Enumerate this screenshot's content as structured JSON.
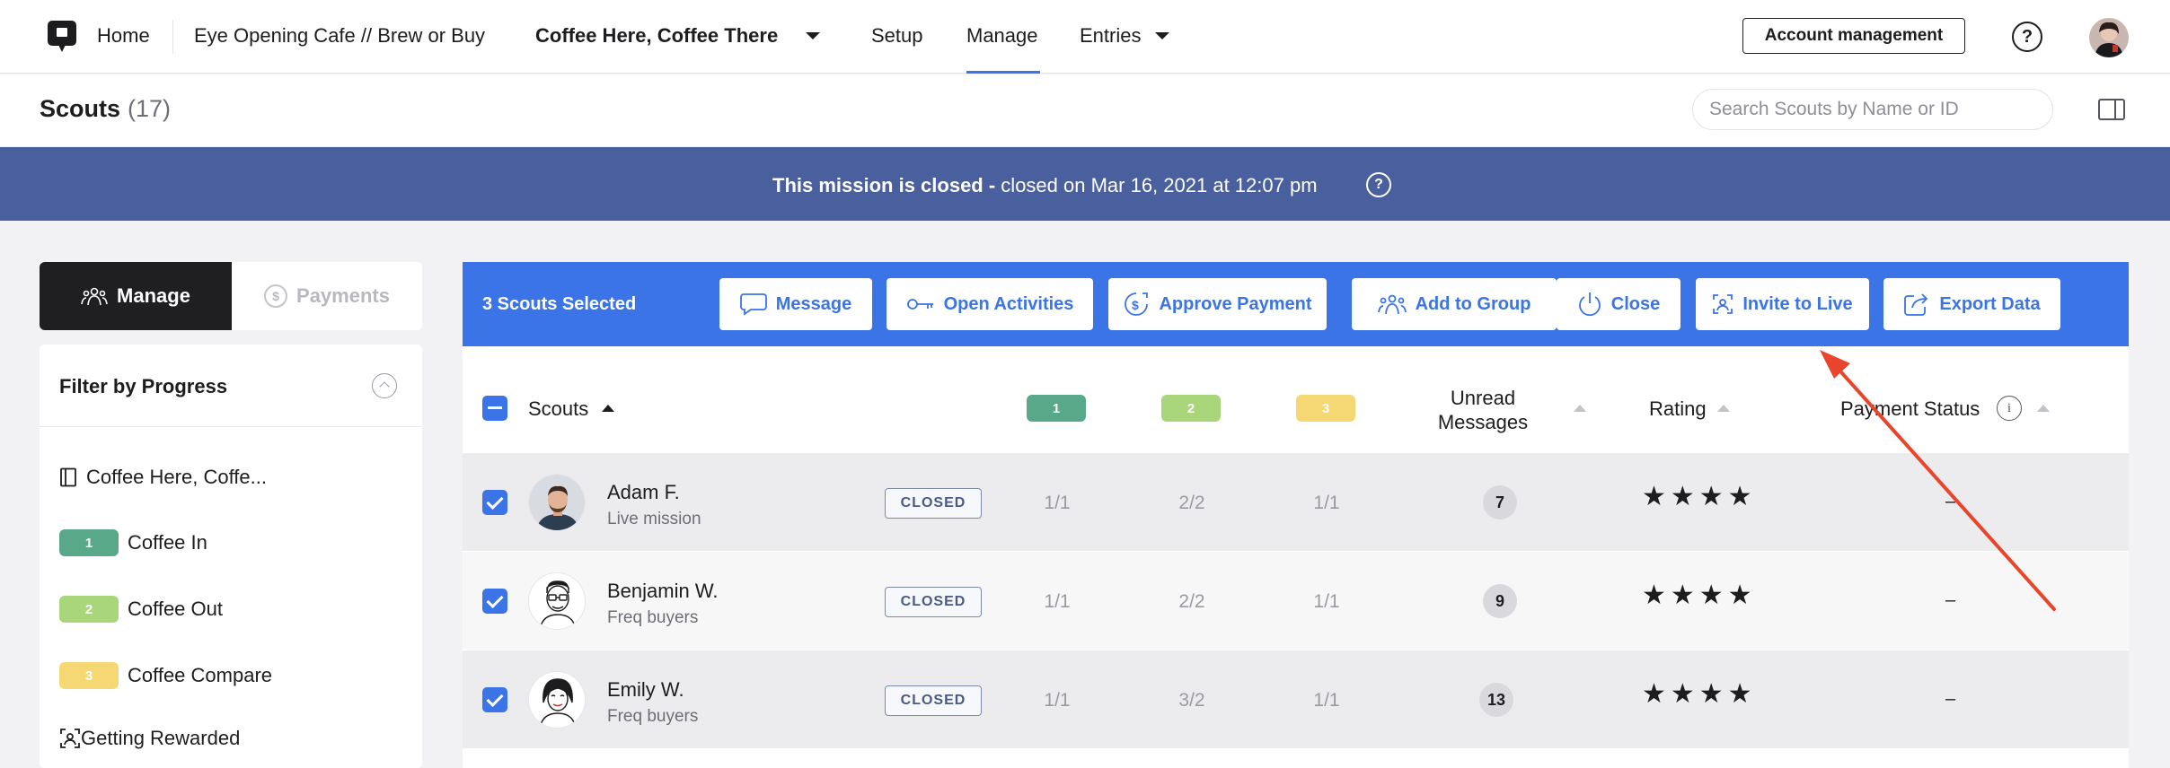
{
  "nav": {
    "home": "Home",
    "breadcrumb": "Eye Opening Cafe // Brew or Buy",
    "mission": "Coffee Here, Coffee There",
    "setup": "Setup",
    "manage": "Manage",
    "entries": "Entries",
    "account": "Account management",
    "help": "?"
  },
  "header": {
    "title": "Scouts",
    "count": "(17)",
    "search_placeholder": "Search Scouts by Name or ID"
  },
  "banner": {
    "bold": "This mission is closed -",
    "rest": " closed on Mar 16, 2021 at 12:07 pm",
    "help": "?"
  },
  "left": {
    "tab_manage": "Manage",
    "tab_payments": "Payments",
    "filter_title": "Filter by Progress",
    "items": [
      {
        "label": "Coffee Here, Coffe...",
        "icon": "book-icon"
      },
      {
        "label": "Coffee In",
        "step": "1",
        "color": "#5aa88a"
      },
      {
        "label": "Coffee Out",
        "step": "2",
        "color": "#a9d67a"
      },
      {
        "label": "Coffee Compare",
        "step": "3",
        "color": "#f5d874"
      },
      {
        "label": "Getting Rewarded",
        "icon": "reward-scan-icon"
      }
    ]
  },
  "actions": {
    "selected": "3 Scouts Selected",
    "message": "Message",
    "open_activities": "Open Activities",
    "approve_payment": "Approve Payment",
    "add_to_group": "Add to Group",
    "close": "Close",
    "invite_to_live": "Invite to Live",
    "export_data": "Export Data",
    "accent": "#3a74e6"
  },
  "table": {
    "col_scouts": "Scouts",
    "col_step1": "1",
    "col_step2": "2",
    "col_step3": "3",
    "col_unread_1": "Unread",
    "col_unread_2": "Messages",
    "col_rating": "Rating",
    "col_payment": "Payment Status",
    "rows": [
      {
        "name": "Adam F.",
        "sub": "Live mission",
        "status": "CLOSED",
        "s1": "1/1",
        "s2": "2/2",
        "s3": "1/1",
        "unread": "7",
        "stars": "★★★★",
        "payment": "–"
      },
      {
        "name": "Benjamin W.",
        "sub": "Freq buyers",
        "status": "CLOSED",
        "s1": "1/1",
        "s2": "2/2",
        "s3": "1/1",
        "unread": "9",
        "stars": "★★★★",
        "payment": "–"
      },
      {
        "name": "Emily W.",
        "sub": "Freq buyers",
        "status": "CLOSED",
        "s1": "1/1",
        "s2": "3/2",
        "s3": "1/1",
        "unread": "13",
        "stars": "★★★★",
        "payment": "–"
      }
    ]
  }
}
